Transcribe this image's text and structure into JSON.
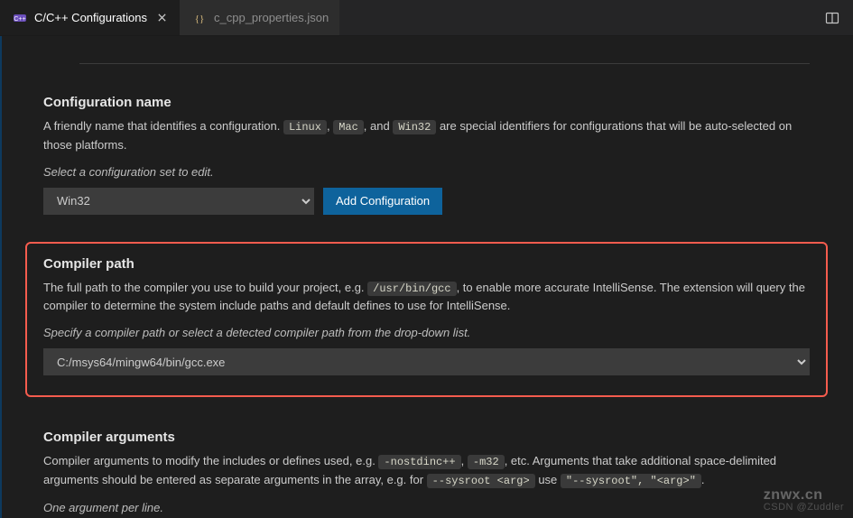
{
  "tabs": {
    "active": {
      "label": "C/C++ Configurations"
    },
    "other": {
      "label": "c_cpp_properties.json"
    }
  },
  "configName": {
    "heading": "Configuration name",
    "desc_pre": "A friendly name that identifies a configuration. ",
    "chip1": "Linux",
    "sep1": ", ",
    "chip2": "Mac",
    "sep2": ", and ",
    "chip3": "Win32",
    "desc_post": " are special identifiers for configurations that will be auto-selected on those platforms.",
    "hint": "Select a configuration set to edit.",
    "selected": "Win32",
    "addBtn": "Add Configuration"
  },
  "compilerPath": {
    "heading": "Compiler path",
    "desc_pre": "The full path to the compiler you use to build your project, e.g. ",
    "chip": "/usr/bin/gcc",
    "desc_post": ", to enable more accurate IntelliSense. The extension will query the compiler to determine the system include paths and default defines to use for IntelliSense.",
    "hint": "Specify a compiler path or select a detected compiler path from the drop-down list.",
    "value": "C:/msys64/mingw64/bin/gcc.exe"
  },
  "compilerArgs": {
    "heading": "Compiler arguments",
    "desc_pre": "Compiler arguments to modify the includes or defines used, e.g. ",
    "chip1": "-nostdinc++",
    "sep1": ", ",
    "chip2": "-m32",
    "desc_mid": ", etc. Arguments that take additional space-delimited arguments should be entered as separate arguments in the array, e.g. for ",
    "chip3": "--sysroot <arg>",
    "desc_mid2": " use ",
    "chip4": "\"--sysroot\", \"<arg>\"",
    "desc_post": ".",
    "hint": "One argument per line."
  },
  "watermark": {
    "main": "znwx.cn",
    "sub": "CSDN @Zuddler"
  }
}
